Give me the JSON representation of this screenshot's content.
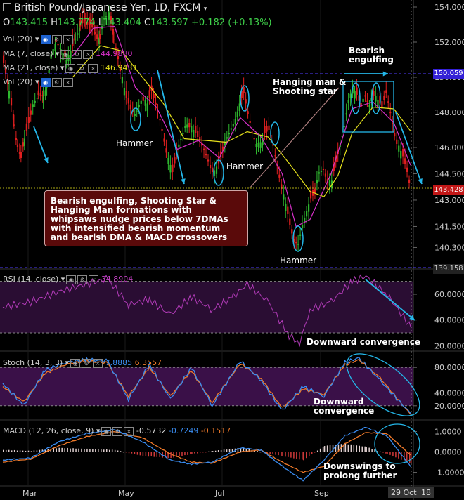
{
  "header": {
    "symbol_title": "British Pound/Japanese Yen, 1D, FXCM",
    "ohlc": {
      "o_label": "O",
      "o": "143.415",
      "h_label": "H",
      "h": "143.774",
      "l_label": "L",
      "l": "143.404",
      "c_label": "C",
      "c": "143.597",
      "change": "+0.182 (+0.13%)"
    }
  },
  "indicators": {
    "vol_label": "Vol (20)",
    "ma7_label": "MA (7, close)",
    "ma7_value": "144.9880",
    "ma21_label": "MA (21, close)",
    "ma21_value": "146.9431",
    "vol2_label": "Vol (20)",
    "rsi_label": "RSI (14, close)",
    "rsi_value": "34.8904",
    "stoch_label": "Stoch (14, 3, 3)",
    "stoch_k": "7.8885",
    "stoch_d": "6.3557",
    "macd_label": "MACD (12, 26, close, 9)",
    "macd_hist": "-0.5732",
    "macd_line": "-0.7249",
    "macd_signal": "-0.1517"
  },
  "annotations": {
    "bearish_engulfing": "Bearish\nengulfing",
    "hanging_man": "Hanging man &\nShooting star",
    "hammer_1": "Hammer",
    "hammer_2": "Hammer",
    "hammer_3": "Hammer",
    "callout": "Bearish engulfing, Shooting Star &\nHanging Man formations with\nwhipsaws nudge prices below 7DMAs\nwith intensified bearish momentum\nand bearish DMA & MACD crossovers",
    "rsi_note": "Downward convergence",
    "stoch_note": "Downward\nconvergence",
    "macd_note": "Downswings to\nprolong further"
  },
  "price_tags": {
    "resistance": "150.059",
    "current": "143.428",
    "low": "139.158"
  },
  "x_axis": {
    "labels": [
      "Mar",
      "May",
      "Jul",
      "Sep"
    ],
    "date_tag": "29 Oct '18"
  },
  "colors": {
    "up": "#2fb82f",
    "down": "#e11f1f",
    "ma7": "#d630c8",
    "ma21": "#e6e21c",
    "arrow": "#24b6e8",
    "resistance": "#4f3cff"
  },
  "chart_data": {
    "type": "candlestick",
    "title": "British Pound/Japanese Yen, 1D, FXCM",
    "price_axis": {
      "ticks": [
        154.0,
        152.0,
        150.0,
        148.0,
        146.0,
        144.5,
        143.0,
        141.5,
        140.3
      ],
      "ylim": [
        139.158,
        154.4
      ]
    },
    "rsi_axis": {
      "ticks": [
        60.0,
        40.0,
        20.0
      ],
      "ylim": [
        18,
        78
      ],
      "levels": [
        70,
        30
      ]
    },
    "stoch_axis": {
      "ticks": [
        80.0,
        40.0,
        20.0
      ],
      "ylim": [
        0,
        100
      ],
      "levels": [
        80,
        20
      ]
    },
    "macd_axis": {
      "ticks": [
        1.0,
        0.0,
        -1.0
      ],
      "ylim": [
        -1.6,
        1.5
      ]
    },
    "close_path": [
      [
        0,
        150.8
      ],
      [
        8,
        149.2
      ],
      [
        15,
        147.3
      ],
      [
        20,
        146.0
      ],
      [
        25,
        145.4
      ],
      [
        30,
        146.5
      ],
      [
        36,
        147.4
      ],
      [
        42,
        148.3
      ],
      [
        50,
        149.0
      ],
      [
        57,
        148.9
      ],
      [
        62,
        149.5
      ],
      [
        68,
        151.3
      ],
      [
        75,
        152.0
      ],
      [
        82,
        151.6
      ],
      [
        90,
        151.0
      ],
      [
        96,
        151.5
      ],
      [
        103,
        152.2
      ],
      [
        110,
        152.9
      ],
      [
        117,
        153.3
      ],
      [
        124,
        153.0
      ],
      [
        131,
        152.6
      ],
      [
        138,
        152.2
      ],
      [
        144,
        153.3
      ],
      [
        151,
        153.7
      ],
      [
        158,
        152.2
      ],
      [
        164,
        151.2
      ],
      [
        170,
        150.0
      ],
      [
        176,
        148.8
      ],
      [
        182,
        148.2
      ],
      [
        188,
        147.8
      ],
      [
        194,
        148.4
      ],
      [
        200,
        148.9
      ],
      [
        206,
        148.5
      ],
      [
        212,
        149.2
      ],
      [
        218,
        148.4
      ],
      [
        224,
        147.6
      ],
      [
        230,
        146.5
      ],
      [
        236,
        145.4
      ],
      [
        242,
        144.6
      ],
      [
        248,
        145.6
      ],
      [
        254,
        146.4
      ],
      [
        260,
        147.2
      ],
      [
        266,
        147.4
      ],
      [
        272,
        147.0
      ],
      [
        278,
        146.6
      ],
      [
        284,
        146.1
      ],
      [
        290,
        145.6
      ],
      [
        296,
        145.0
      ],
      [
        302,
        144.7
      ],
      [
        308,
        145.1
      ],
      [
        314,
        145.8
      ],
      [
        320,
        146.5
      ],
      [
        326,
        147.1
      ],
      [
        332,
        147.6
      ],
      [
        338,
        148.5
      ],
      [
        344,
        149.1
      ],
      [
        350,
        147.9
      ],
      [
        356,
        146.9
      ],
      [
        362,
        146.2
      ],
      [
        368,
        146.3
      ],
      [
        374,
        146.8
      ],
      [
        380,
        147.0
      ],
      [
        386,
        146.1
      ],
      [
        392,
        145.0
      ],
      [
        398,
        143.9
      ],
      [
        404,
        142.8
      ],
      [
        410,
        141.6
      ],
      [
        416,
        140.6
      ],
      [
        422,
        140.5
      ],
      [
        428,
        141.6
      ],
      [
        434,
        142.4
      ],
      [
        440,
        143.1
      ],
      [
        446,
        143.4
      ],
      [
        452,
        144.5
      ],
      [
        458,
        144.8
      ],
      [
        464,
        144.2
      ],
      [
        470,
        144.1
      ],
      [
        476,
        145.2
      ],
      [
        482,
        146.0
      ],
      [
        488,
        147.2
      ],
      [
        494,
        148.7
      ],
      [
        500,
        149.4
      ],
      [
        506,
        149.0
      ],
      [
        512,
        148.3
      ],
      [
        518,
        148.9
      ],
      [
        524,
        148.4
      ],
      [
        530,
        149.2
      ],
      [
        536,
        148.7
      ],
      [
        542,
        148.3
      ],
      [
        548,
        149.1
      ],
      [
        554,
        148.0
      ],
      [
        560,
        146.8
      ],
      [
        566,
        146.1
      ],
      [
        572,
        145.5
      ],
      [
        578,
        144.6
      ],
      [
        584,
        143.4
      ]
    ],
    "ma7_path": [
      [
        100,
        151.2
      ],
      [
        130,
        152.8
      ],
      [
        160,
        152.9
      ],
      [
        190,
        149.4
      ],
      [
        220,
        148.3
      ],
      [
        250,
        145.9
      ],
      [
        280,
        146.4
      ],
      [
        310,
        145.4
      ],
      [
        340,
        147.7
      ],
      [
        370,
        146.6
      ],
      [
        400,
        144.5
      ],
      [
        420,
        141.5
      ],
      [
        440,
        141.9
      ],
      [
        470,
        144.5
      ],
      [
        500,
        148.2
      ],
      [
        530,
        148.6
      ],
      [
        560,
        147.4
      ],
      [
        584,
        144.99
      ]
    ],
    "ma21_path": [
      [
        100,
        150.0
      ],
      [
        140,
        151.8
      ],
      [
        170,
        151.5
      ],
      [
        200,
        150.0
      ],
      [
        230,
        148.5
      ],
      [
        260,
        146.5
      ],
      [
        290,
        146.4
      ],
      [
        320,
        146.3
      ],
      [
        350,
        146.9
      ],
      [
        380,
        146.6
      ],
      [
        410,
        145.1
      ],
      [
        440,
        143.5
      ],
      [
        460,
        143.2
      ],
      [
        480,
        144.4
      ],
      [
        500,
        146.8
      ],
      [
        530,
        148.3
      ],
      [
        560,
        148.2
      ],
      [
        584,
        146.94
      ]
    ],
    "rsi_path": [
      [
        0,
        50
      ],
      [
        40,
        54
      ],
      [
        80,
        62
      ],
      [
        120,
        68
      ],
      [
        150,
        72
      ],
      [
        180,
        52
      ],
      [
        210,
        56
      ],
      [
        240,
        44
      ],
      [
        270,
        58
      ],
      [
        300,
        48
      ],
      [
        330,
        58
      ],
      [
        350,
        68
      ],
      [
        380,
        54
      ],
      [
        410,
        28
      ],
      [
        425,
        22
      ],
      [
        440,
        48
      ],
      [
        470,
        54
      ],
      [
        500,
        70
      ],
      [
        520,
        74
      ],
      [
        550,
        60
      ],
      [
        584,
        34.89
      ]
    ],
    "stoch_k_path": [
      [
        0,
        55
      ],
      [
        30,
        20
      ],
      [
        60,
        75
      ],
      [
        90,
        88
      ],
      [
        120,
        92
      ],
      [
        150,
        90
      ],
      [
        180,
        30
      ],
      [
        210,
        85
      ],
      [
        240,
        30
      ],
      [
        270,
        80
      ],
      [
        300,
        20
      ],
      [
        340,
        90
      ],
      [
        370,
        60
      ],
      [
        400,
        12
      ],
      [
        430,
        50
      ],
      [
        460,
        35
      ],
      [
        490,
        88
      ],
      [
        510,
        95
      ],
      [
        540,
        60
      ],
      [
        584,
        7.89
      ]
    ],
    "stoch_d_path": [
      [
        0,
        50
      ],
      [
        30,
        26
      ],
      [
        60,
        70
      ],
      [
        90,
        85
      ],
      [
        120,
        90
      ],
      [
        150,
        87
      ],
      [
        180,
        35
      ],
      [
        210,
        80
      ],
      [
        240,
        35
      ],
      [
        270,
        75
      ],
      [
        300,
        25
      ],
      [
        340,
        86
      ],
      [
        370,
        63
      ],
      [
        400,
        16
      ],
      [
        430,
        46
      ],
      [
        460,
        38
      ],
      [
        490,
        84
      ],
      [
        510,
        92
      ],
      [
        540,
        64
      ],
      [
        584,
        6.36
      ]
    ],
    "macd_line_path": [
      [
        0,
        -0.4
      ],
      [
        40,
        -0.3
      ],
      [
        80,
        0.5
      ],
      [
        120,
        0.9
      ],
      [
        160,
        1.1
      ],
      [
        200,
        0.5
      ],
      [
        240,
        -0.4
      ],
      [
        270,
        -0.6
      ],
      [
        300,
        -0.5
      ],
      [
        340,
        0.2
      ],
      [
        370,
        0.1
      ],
      [
        400,
        -0.7
      ],
      [
        430,
        -1.4
      ],
      [
        460,
        -0.4
      ],
      [
        490,
        0.8
      ],
      [
        520,
        1.2
      ],
      [
        550,
        0.8
      ],
      [
        584,
        -0.72
      ]
    ],
    "macd_signal_path": [
      [
        0,
        -0.5
      ],
      [
        40,
        -0.35
      ],
      [
        80,
        0.3
      ],
      [
        120,
        0.75
      ],
      [
        160,
        1.0
      ],
      [
        200,
        0.7
      ],
      [
        240,
        -0.1
      ],
      [
        270,
        -0.5
      ],
      [
        300,
        -0.55
      ],
      [
        340,
        0.0
      ],
      [
        370,
        0.1
      ],
      [
        400,
        -0.5
      ],
      [
        430,
        -1.0
      ],
      [
        460,
        -0.7
      ],
      [
        490,
        0.4
      ],
      [
        520,
        0.95
      ],
      [
        550,
        0.9
      ],
      [
        584,
        -0.15
      ]
    ]
  }
}
